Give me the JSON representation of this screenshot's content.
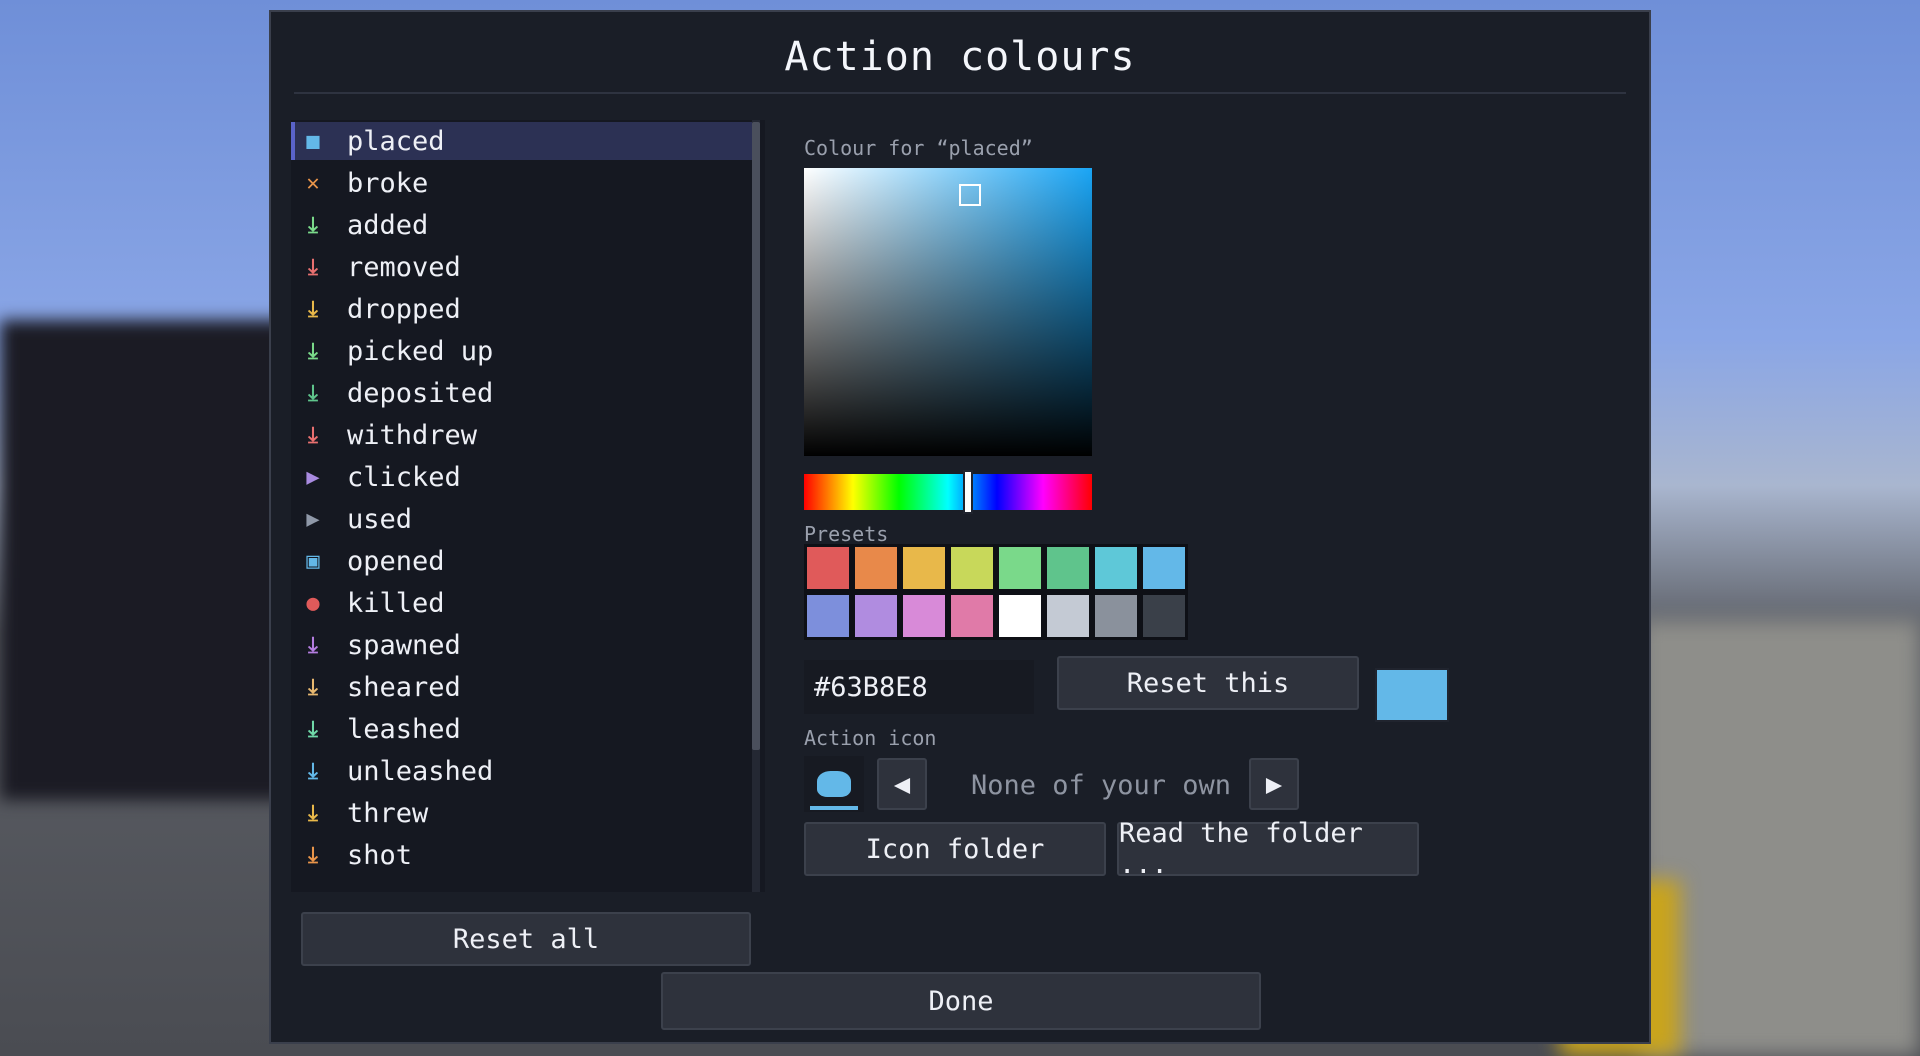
{
  "window": {
    "title": "Action colours"
  },
  "actions": [
    {
      "label": "placed",
      "icon": "cube-icon",
      "color": "#63b8e8",
      "glyph": "■"
    },
    {
      "label": "broke",
      "icon": "cross-icon",
      "color": "#e8944a",
      "glyph": "✕"
    },
    {
      "label": "added",
      "icon": "arrow-down-icon",
      "color": "#7ad98a",
      "glyph": "⤓"
    },
    {
      "label": "removed",
      "icon": "arrow-down-icon",
      "color": "#e87070",
      "glyph": "⤓"
    },
    {
      "label": "dropped",
      "icon": "arrow-down-icon",
      "color": "#e8b84a",
      "glyph": "⤓"
    },
    {
      "label": "picked up",
      "icon": "arrow-down-icon",
      "color": "#7ad98a",
      "glyph": "⤓"
    },
    {
      "label": "deposited",
      "icon": "arrow-down-icon",
      "color": "#5fc48c",
      "glyph": "⤓"
    },
    {
      "label": "withdrew",
      "icon": "arrow-down-icon",
      "color": "#e87070",
      "glyph": "⤓"
    },
    {
      "label": "clicked",
      "icon": "cursor-icon",
      "color": "#a98be0",
      "glyph": "▶"
    },
    {
      "label": "used",
      "icon": "cursor-icon",
      "color": "#8f98a8",
      "glyph": "▶"
    },
    {
      "label": "opened",
      "icon": "chest-icon",
      "color": "#63b8e8",
      "glyph": "▣"
    },
    {
      "label": "killed",
      "icon": "skull-icon",
      "color": "#e05a5a",
      "glyph": "●"
    },
    {
      "label": "spawned",
      "icon": "arrow-down-icon",
      "color": "#b47de0",
      "glyph": "⤓"
    },
    {
      "label": "sheared",
      "icon": "arrow-down-icon",
      "color": "#e8b870",
      "glyph": "⤓"
    },
    {
      "label": "leashed",
      "icon": "arrow-down-icon",
      "color": "#6fd8a8",
      "glyph": "⤓"
    },
    {
      "label": "unleashed",
      "icon": "arrow-down-icon",
      "color": "#63b8e8",
      "glyph": "⤓"
    },
    {
      "label": "threw",
      "icon": "arrow-down-icon",
      "color": "#e8b84a",
      "glyph": "⤓"
    },
    {
      "label": "shot",
      "icon": "arrow-down-icon",
      "color": "#e8944a",
      "glyph": "⤓"
    }
  ],
  "selected_index": 0,
  "editor": {
    "colour_for_label": "Colour for “placed”",
    "presets_label": "Presets",
    "hex_value": "#63B8E8",
    "current_color": "#63b8e8",
    "reset_this_label": "Reset this",
    "action_icon_label": "Action icon",
    "icon_name": "None of your own",
    "icon_folder_label": "Icon folder",
    "read_folder_label": "Read the folder ..."
  },
  "presets": [
    "#e05a5a",
    "#e8894a",
    "#e8b84a",
    "#c8d85a",
    "#7ad98a",
    "#5fc48c",
    "#5ec8d8",
    "#63b8e8",
    "#7d8fdc",
    "#b08ce0",
    "#d88ad8",
    "#e07aa8",
    "#ffffff",
    "#c4cad4",
    "#8a919c",
    "#3a4049"
  ],
  "footer": {
    "reset_all_label": "Reset all",
    "done_label": "Done"
  }
}
